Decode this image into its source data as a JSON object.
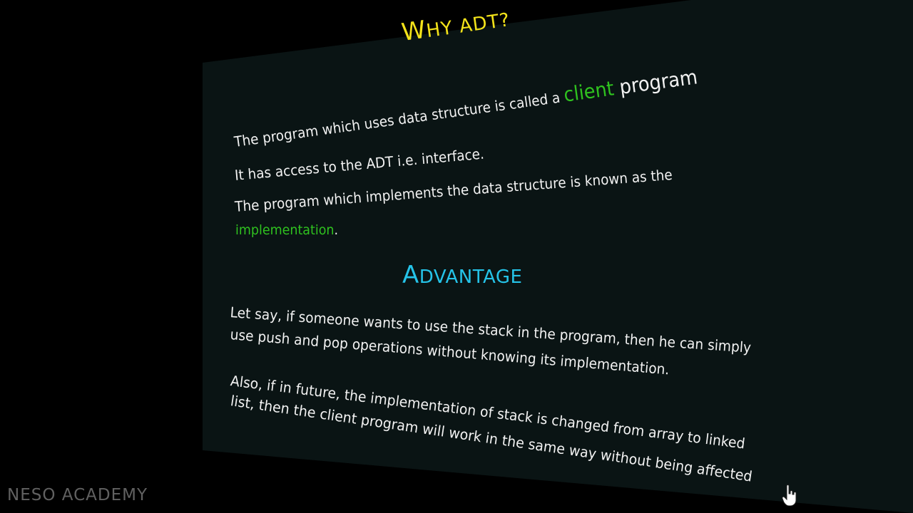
{
  "slide": {
    "title_first": "W",
    "title_rest": "HY ADT?",
    "lines": {
      "l1_pre": "The program which uses data structure is called a ",
      "l1_hl": "client",
      "l1_post": " program",
      "l2": "It has access to the ADT i.e. interface.",
      "l3": "The program which implements the data structure is known as the",
      "l4_hl": "implementation",
      "l4_post": "."
    },
    "advantage_first": "A",
    "advantage_rest": "DVANTAGE",
    "adv_lines": {
      "a1": "Let say, if someone wants to use the stack in the program, then he can simply",
      "a2": "use push and pop operations without knowing its implementation.",
      "a3": "Also, if in future, the implementation of stack is changed from array to linked",
      "a4": "list, then the client program will work in the same way without being affected"
    }
  },
  "watermark": "NESO ACADEMY",
  "colors": {
    "title": "#f2e21a",
    "highlight": "#2fc21f",
    "heading": "#25c3e8",
    "text": "#f2f2f2"
  }
}
